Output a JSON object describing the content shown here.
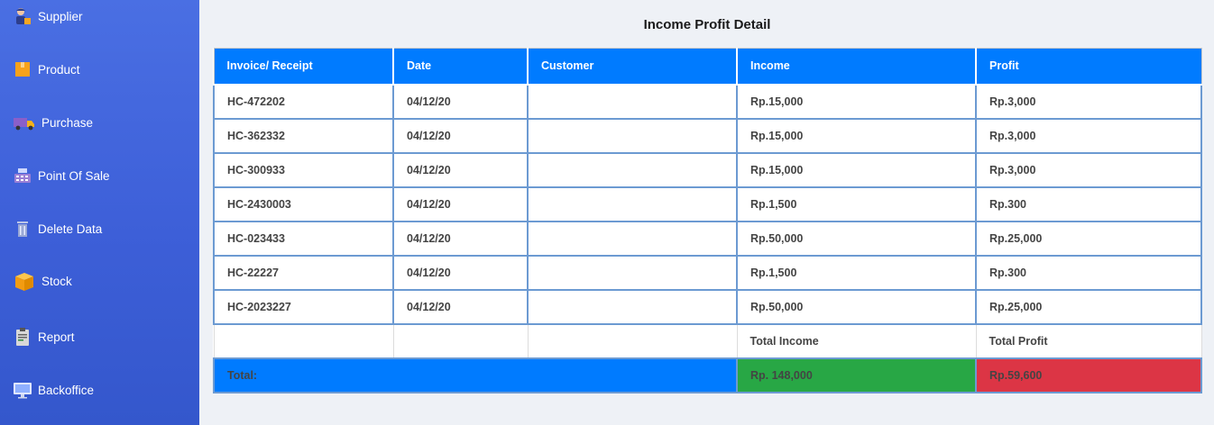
{
  "sidebar": {
    "items": [
      {
        "label": "Supplier",
        "icon": "supplier-icon"
      },
      {
        "label": "Product",
        "icon": "product-box-icon"
      },
      {
        "label": "Purchase",
        "icon": "delivery-truck-icon"
      },
      {
        "label": "Point Of Sale",
        "icon": "cash-register-icon"
      },
      {
        "label": "Delete Data",
        "icon": "trash-icon"
      },
      {
        "label": "Stock",
        "icon": "stock-box-icon"
      },
      {
        "label": "Report",
        "icon": "report-clipboard-icon"
      },
      {
        "label": "Backoffice",
        "icon": "monitor-icon"
      }
    ]
  },
  "page": {
    "title": "Income Profit Detail"
  },
  "table": {
    "headers": [
      "Invoice/ Receipt",
      "Date",
      "Customer",
      "Income",
      "Profit"
    ],
    "rows": [
      [
        "HC-472202",
        "04/12/20",
        "",
        "Rp.15,000",
        "Rp.3,000"
      ],
      [
        "HC-362332",
        "04/12/20",
        "",
        "Rp.15,000",
        "Rp.3,000"
      ],
      [
        "HC-300933",
        "04/12/20",
        "",
        "Rp.15,000",
        "Rp.3,000"
      ],
      [
        "HC-2430003",
        "04/12/20",
        "",
        "Rp.1,500",
        "Rp.300"
      ],
      [
        "HC-023433",
        "04/12/20",
        "",
        "Rp.50,000",
        "Rp.25,000"
      ],
      [
        "HC-22227",
        "04/12/20",
        "",
        "Rp.1,500",
        "Rp.300"
      ],
      [
        "HC-2023227",
        "04/12/20",
        "",
        "Rp.50,000",
        "Rp.25,000"
      ]
    ],
    "summary": {
      "income_label": "Total Income",
      "profit_label": "Total Profit"
    },
    "total": {
      "label": "Total:",
      "income": "Rp. 148,000",
      "profit": "Rp.59,600"
    }
  },
  "colors": {
    "sidebar": "#4166dd",
    "header": "#007bff",
    "income_total": "#28a745",
    "profit_total": "#dc3545"
  }
}
